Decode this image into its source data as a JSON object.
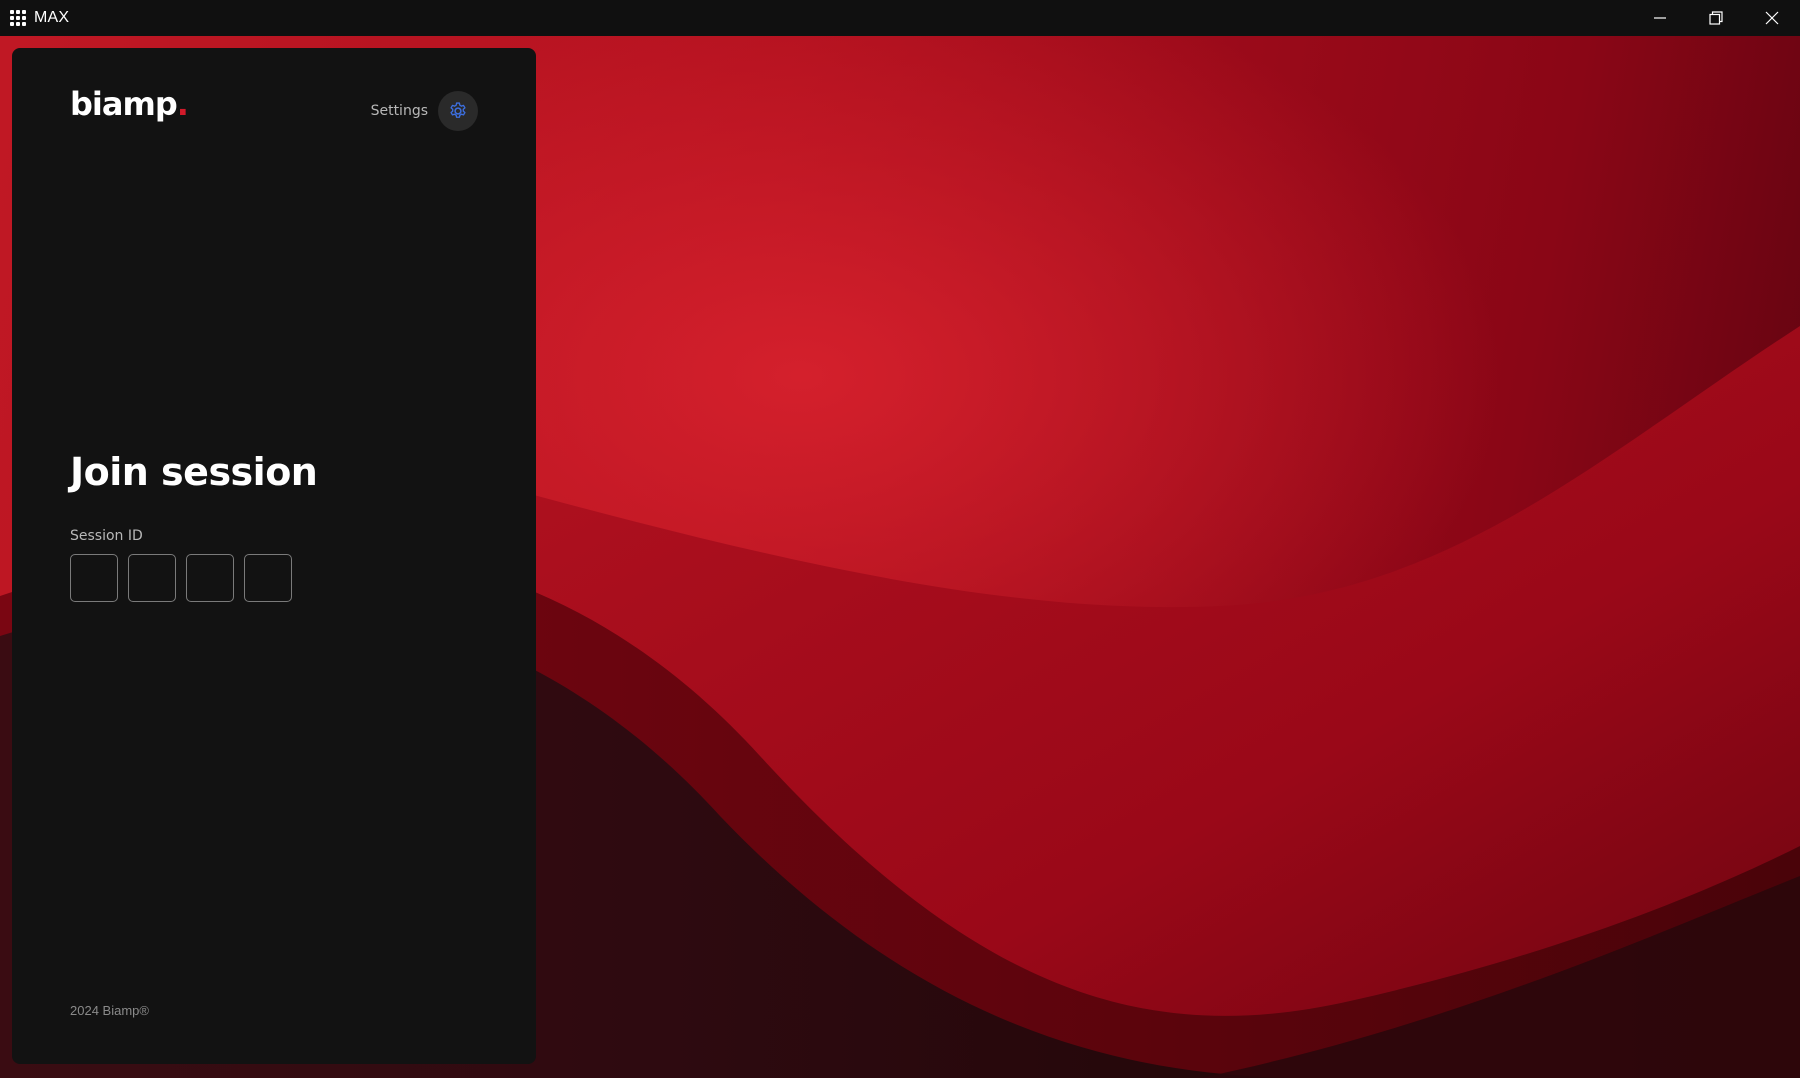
{
  "window": {
    "title": "MAX",
    "menu_icon": "app-grid-icon",
    "controls": [
      "minimize-icon",
      "restore-icon",
      "close-icon"
    ]
  },
  "panel": {
    "logo_text": "biamp",
    "logo_dot": ".",
    "settings_label": "Settings",
    "settings_icon": "gear-icon",
    "heading": "Join session",
    "session_id_label": "Session ID",
    "session_id_digits": [
      "",
      "",
      "",
      ""
    ],
    "footer": "2024 Biamp®"
  },
  "colors": {
    "accent": "#3d6fe0",
    "brand_red": "#d11a2a",
    "panel_bg": "#121212",
    "titlebar_bg": "#101010"
  }
}
